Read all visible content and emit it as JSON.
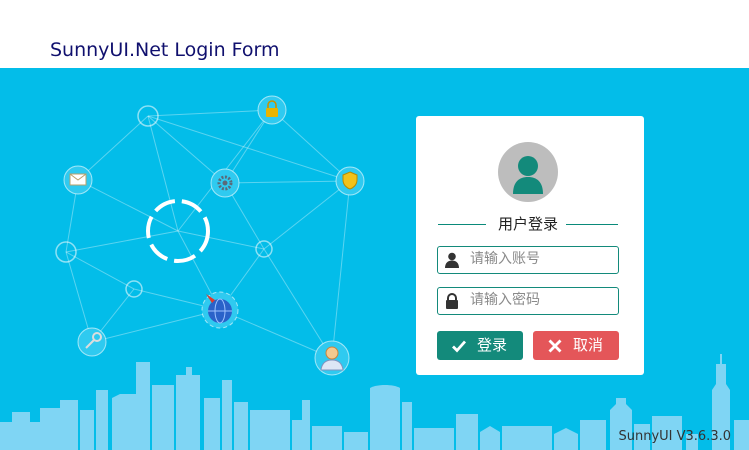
{
  "window": {
    "title": "SunnyUI.Net Login Form"
  },
  "login": {
    "title": "用户登录",
    "username_placeholder": "请输入账号",
    "password_placeholder": "请输入密码",
    "login_label": "登录",
    "cancel_label": "取消"
  },
  "footer": {
    "version": "SunnyUI V3.6.3.0"
  },
  "icons": {
    "user": "user-icon",
    "lock": "lock-icon",
    "check": "check-icon",
    "close": "close-icon",
    "avatar": "avatar-icon"
  },
  "colors": {
    "background": "#03bde9",
    "title": "#10106e",
    "primary": "#138a7b",
    "danger": "#e45659"
  }
}
